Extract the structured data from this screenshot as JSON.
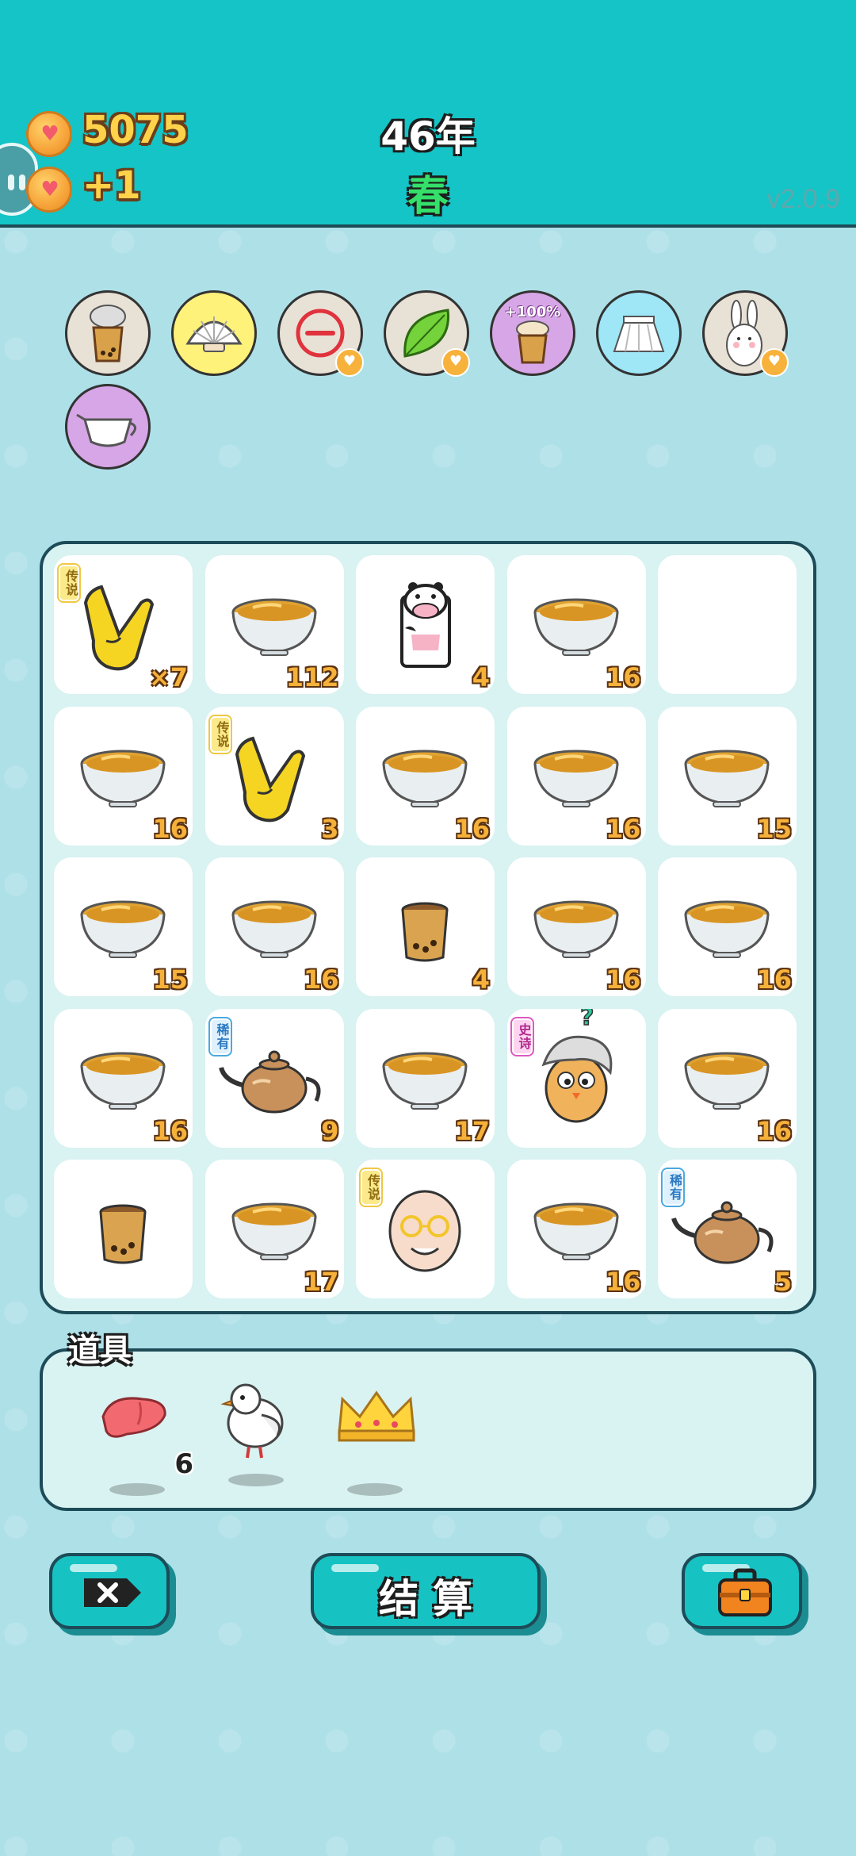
{
  "header": {
    "coins": "5075",
    "coin_income": "+1",
    "year": "46年",
    "season": "春",
    "version": "v2.0.9"
  },
  "buffs": [
    {
      "icon": "bubble-tea-lid-icon",
      "bg": "#e8e2d6"
    },
    {
      "icon": "shell-icon",
      "bg": "#fff27a"
    },
    {
      "icon": "minus-circle-icon",
      "bg": "#e8e2d6",
      "heart": true
    },
    {
      "icon": "leaf-icon",
      "bg": "#e8e2d6",
      "heart": true
    },
    {
      "icon": "cup-plus-icon",
      "bg": "#d7a6e6",
      "label": "+100%"
    },
    {
      "icon": "skirt-icon",
      "bg": "#9fe6f7"
    },
    {
      "icon": "rabbit-icon",
      "bg": "#e8e2d6",
      "heart": true
    },
    {
      "icon": "milk-jug-icon",
      "bg": "#d7a6e6"
    }
  ],
  "grid": [
    [
      {
        "item": "pointing-hand",
        "tag": "传说",
        "tag_type": "legend",
        "count": "×7"
      },
      {
        "item": "tea-bowl",
        "count": "112"
      },
      {
        "item": "cow",
        "count": "4"
      },
      {
        "item": "tea-bowl",
        "count": "16"
      },
      {
        "item": "empty",
        "count": ""
      }
    ],
    [
      {
        "item": "tea-bowl",
        "count": "16"
      },
      {
        "item": "pointing-hand",
        "tag": "传说",
        "tag_type": "legend",
        "count": "3"
      },
      {
        "item": "tea-bowl",
        "count": "16"
      },
      {
        "item": "tea-bowl",
        "count": "16"
      },
      {
        "item": "tea-bowl",
        "count": "15"
      }
    ],
    [
      {
        "item": "tea-bowl",
        "count": "15"
      },
      {
        "item": "tea-bowl",
        "count": "16"
      },
      {
        "item": "tea-cup",
        "count": "4"
      },
      {
        "item": "tea-bowl",
        "count": "16"
      },
      {
        "item": "tea-bowl",
        "count": "16"
      }
    ],
    [
      {
        "item": "tea-bowl",
        "count": "16"
      },
      {
        "item": "teapot",
        "tag": "稀有",
        "tag_type": "rare",
        "count": "9"
      },
      {
        "item": "tea-bowl",
        "count": "17"
      },
      {
        "item": "chick-character",
        "tag": "史诗",
        "tag_type": "epic",
        "count": ""
      },
      {
        "item": "tea-bowl",
        "count": "16"
      }
    ],
    [
      {
        "item": "tea-cup",
        "count": ""
      },
      {
        "item": "tea-bowl",
        "count": "17"
      },
      {
        "item": "old-man",
        "tag": "传说",
        "tag_type": "legend",
        "count": ""
      },
      {
        "item": "tea-bowl",
        "count": "16"
      },
      {
        "item": "teapot",
        "tag": "稀有",
        "tag_type": "rare",
        "count": "5"
      }
    ]
  ],
  "items_panel": {
    "title": "道具",
    "tools": [
      {
        "icon": "liver-icon",
        "count": "6"
      },
      {
        "icon": "bird-icon",
        "count": ""
      },
      {
        "icon": "crown-icon",
        "count": ""
      }
    ]
  },
  "buttons": {
    "settle": "结算"
  }
}
